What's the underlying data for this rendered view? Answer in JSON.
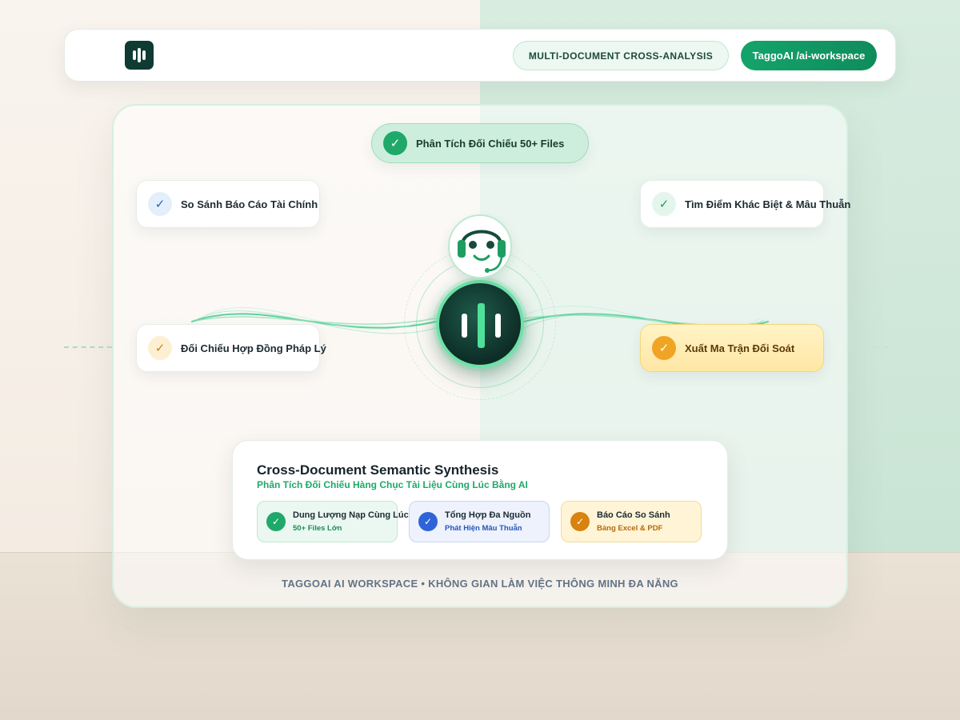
{
  "header": {
    "badge_label": "MULTI-DOCUMENT CROSS-ANALYSIS",
    "workspace_button": "TaggoAI /ai-workspace"
  },
  "features": {
    "top": "Phân Tích Đối Chiếu 50+ Files",
    "finance": "So Sánh Báo Cáo Tài Chính",
    "differences": "Tìm Điểm Khác Biệt & Mâu Thuẫn",
    "legal": "Đối Chiếu Hợp Đồng Pháp Lý",
    "export": "Xuất Ma Trận Đối Soát"
  },
  "panel": {
    "title": "Cross-Document Semantic Synthesis",
    "subtitle": "Phân Tích Đối Chiếu Hàng Chục Tài Liệu Cùng Lúc Bằng AI",
    "items": [
      {
        "title": "Dung Lượng Nạp Cùng Lúc",
        "detail": "50+ Files Lớn"
      },
      {
        "title": "Tổng Hợp Đa Nguồn",
        "detail": "Phát Hiện Mâu Thuẫn"
      },
      {
        "title": "Báo Cáo So Sánh",
        "detail": "Bảng Excel & PDF"
      }
    ]
  },
  "footer": "TAGGOAI AI WORKSPACE • KHÔNG GIAN LÀM VIỆC THÔNG MINH ĐA NĂNG",
  "icons": {
    "logo": "sound-bars-logo",
    "check": "check-icon",
    "assistant": "headset-bot-icon",
    "hub": "voice-bars-icon"
  },
  "colors": {
    "brand_green": "#1ea96a",
    "dark_teal": "#0f3b33",
    "accent_amber": "#f0a424",
    "accent_blue": "#2f63d8"
  }
}
